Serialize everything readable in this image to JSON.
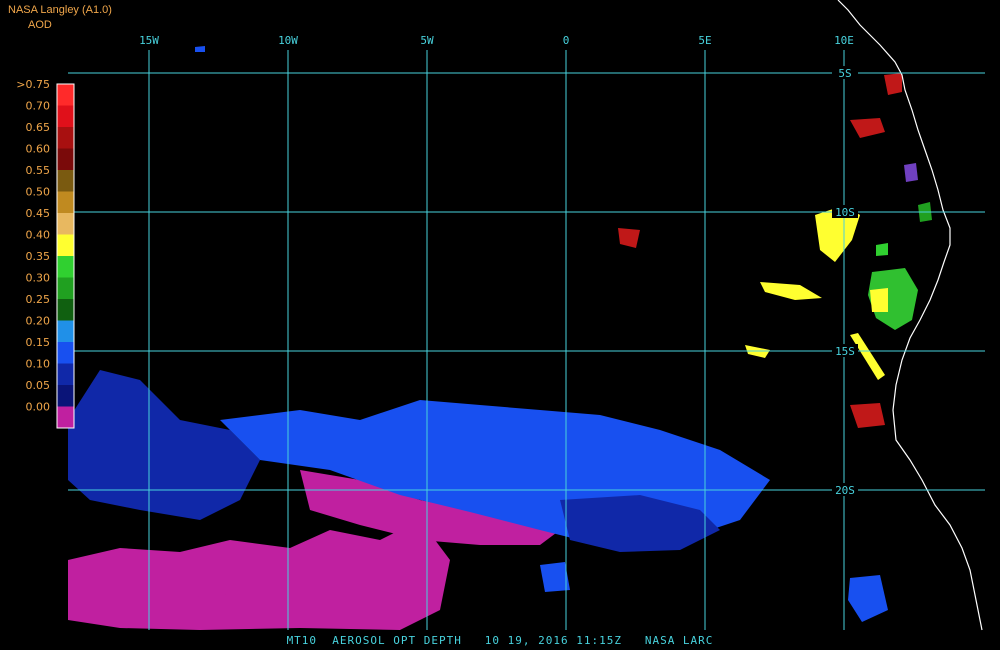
{
  "header": {
    "source": "NASA Langley (A1.0)",
    "product": "AOD"
  },
  "caption": "MT10  AEROSOL OPT DEPTH   10 19, 2016 11:15Z   NASA LARC",
  "grid": {
    "longitudes": [
      {
        "label": "15W",
        "value": -15
      },
      {
        "label": "10W",
        "value": -10
      },
      {
        "label": "5W",
        "value": -5
      },
      {
        "label": "0",
        "value": 0
      },
      {
        "label": "5E",
        "value": 5
      },
      {
        "label": "10E",
        "value": 10
      }
    ],
    "latitudes": [
      {
        "label": "5S",
        "value": -5
      },
      {
        "label": "10S",
        "value": -10
      },
      {
        "label": "15S",
        "value": -15
      },
      {
        "label": "20S",
        "value": -20
      }
    ],
    "color": "#48d2dd"
  },
  "legend": {
    "title": "AOD",
    "entries": [
      {
        "label": ">0.75",
        "color": "#ff2a2a"
      },
      {
        "label": "0.70",
        "color": "#e0101a"
      },
      {
        "label": "0.65",
        "color": "#a81010"
      },
      {
        "label": "0.60",
        "color": "#7a0a0a"
      },
      {
        "label": "0.55",
        "color": "#7a5a10"
      },
      {
        "label": "0.50",
        "color": "#c08a20"
      },
      {
        "label": "0.45",
        "color": "#e8b860"
      },
      {
        "label": "0.40",
        "color": "#ffff30"
      },
      {
        "label": "0.35",
        "color": "#30d030"
      },
      {
        "label": "0.30",
        "color": "#20a020"
      },
      {
        "label": "0.25",
        "color": "#106010"
      },
      {
        "label": "0.20",
        "color": "#2090e8"
      },
      {
        "label": "0.15",
        "color": "#1850f0"
      },
      {
        "label": "0.10",
        "color": "#1028a8"
      },
      {
        "label": "0.05",
        "color": "#0a1478"
      },
      {
        "label": "0.00",
        "color": "#c020a0"
      }
    ]
  },
  "colors": {
    "coast": "#ffffff",
    "low_aod": "#c020a0",
    "mid_aod": "#1850f0",
    "dark_aod": "#1028a8",
    "high_aod": "#ffff30",
    "smoke_red": "#c01818",
    "green": "#30c030"
  }
}
